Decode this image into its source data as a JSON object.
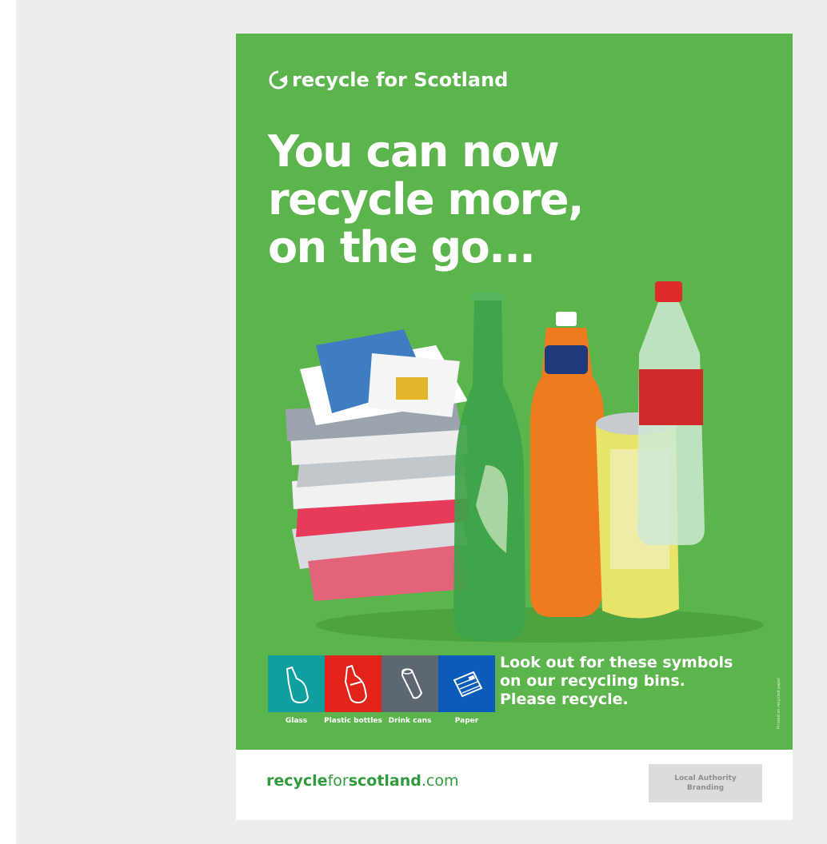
{
  "logo": {
    "text": "recycle for Scotland"
  },
  "headline": {
    "line1": "You can now",
    "line2": "recycle more,",
    "line3": "on the go..."
  },
  "symbols": [
    {
      "label": "Glass",
      "color": "#0f9f9f",
      "icon": "glass-bottle-icon"
    },
    {
      "label": "Plastic bottles",
      "color": "#e2231a",
      "icon": "plastic-bottle-icon"
    },
    {
      "label": "Drink cans",
      "color": "#5c6770",
      "icon": "drink-can-icon"
    },
    {
      "label": "Paper",
      "color": "#0a5cb8",
      "icon": "paper-icon"
    }
  ],
  "tagline": {
    "line1": "Look out for these symbols",
    "line2": "on our recycling bins.",
    "line3": "Please recycle."
  },
  "printed_note": "Printed on recycled paper",
  "footer": {
    "url_part1": "recycle",
    "url_part2": "for",
    "url_part3": "scotland",
    "url_part4": ".com",
    "branding_line1": "Local Authority",
    "branding_line2": "Branding"
  },
  "colors": {
    "poster_green": "#5cb54c",
    "url_green": "#2f9b3a"
  }
}
